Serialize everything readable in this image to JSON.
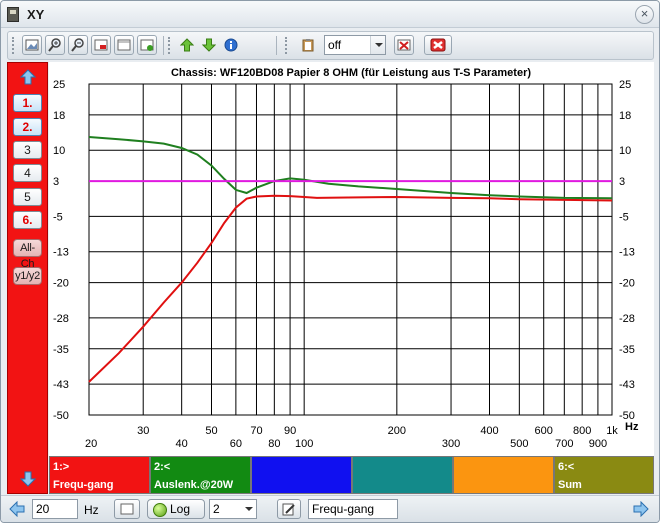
{
  "window": {
    "title": "XY",
    "close_glyph": "×"
  },
  "toolbar": {
    "select_value": "off",
    "icons": [
      "image-icon",
      "zoom-in-icon",
      "zoom-out-icon",
      "screen-red-icon",
      "screen-icon",
      "screen-green-icon",
      "arrow-up-icon",
      "arrow-down-icon",
      "info-icon",
      "clipboard-icon",
      "delete-icon",
      "cancel-icon"
    ]
  },
  "sidebar": {
    "channels": [
      {
        "label": "1.",
        "active": true,
        "highlight": true
      },
      {
        "label": "2.",
        "active": true,
        "highlight": true
      },
      {
        "label": "3",
        "active": false,
        "highlight": false
      },
      {
        "label": "4",
        "active": false,
        "highlight": false
      },
      {
        "label": "5",
        "active": false,
        "highlight": false
      },
      {
        "label": "6.",
        "active": false,
        "highlight": true
      }
    ],
    "all_label": "All-Ch",
    "y_label": "y1/y2"
  },
  "chart_data": {
    "type": "line",
    "title": "Chassis: WF120BD08 Papier 8 OHM (für Leistung aus T-S Parameter)",
    "x_scale": "log",
    "xlim": [
      20,
      1000
    ],
    "ylim": [
      -50,
      25
    ],
    "x_unit": "Hz",
    "x_ticks": [
      {
        "v": 20,
        "label": "20",
        "row": 2
      },
      {
        "v": 30,
        "label": "30",
        "row": 1
      },
      {
        "v": 40,
        "label": "40",
        "row": 2
      },
      {
        "v": 50,
        "label": "50",
        "row": 1
      },
      {
        "v": 60,
        "label": "60",
        "row": 2
      },
      {
        "v": 70,
        "label": "70",
        "row": 1
      },
      {
        "v": 80,
        "label": "80",
        "row": 2
      },
      {
        "v": 90,
        "label": "90",
        "row": 1
      },
      {
        "v": 100,
        "label": "100",
        "row": 2
      },
      {
        "v": 200,
        "label": "200",
        "row": 1
      },
      {
        "v": 300,
        "label": "300",
        "row": 2
      },
      {
        "v": 400,
        "label": "400",
        "row": 1
      },
      {
        "v": 500,
        "label": "500",
        "row": 2
      },
      {
        "v": 600,
        "label": "600",
        "row": 1
      },
      {
        "v": 700,
        "label": "700",
        "row": 2
      },
      {
        "v": 800,
        "label": "800",
        "row": 1
      },
      {
        "v": 900,
        "label": "900",
        "row": 2
      },
      {
        "v": 1000,
        "label": "1k",
        "row": 1
      }
    ],
    "y_ticks_left": [
      {
        "v": 25,
        "label": "25"
      },
      {
        "v": 18,
        "label": "18"
      },
      {
        "v": 10,
        "label": "10"
      },
      {
        "v": 3,
        "label": "3"
      },
      {
        "v": -5,
        "label": "-5"
      },
      {
        "v": -13,
        "label": "-13"
      },
      {
        "v": -20,
        "label": "-20"
      },
      {
        "v": -28,
        "label": "-28"
      },
      {
        "v": -35,
        "label": "-35"
      },
      {
        "v": -43,
        "label": "-43"
      },
      {
        "v": -50,
        "label": "-50"
      }
    ],
    "y_ticks_right": [
      {
        "v": 25,
        "label": "25"
      },
      {
        "v": 18,
        "label": "18"
      },
      {
        "v": 10,
        "label": "10"
      },
      {
        "v": 3,
        "label": "3"
      },
      {
        "v": -5,
        "label": "-5"
      },
      {
        "v": -13,
        "label": "-13"
      },
      {
        "v": -20,
        "label": "-20"
      },
      {
        "v": -28,
        "label": "-28"
      },
      {
        "v": -35,
        "label": "-35"
      },
      {
        "v": -43,
        "label": "-43"
      },
      {
        "v": -50,
        "label": "-50"
      }
    ],
    "hgrid": [
      25,
      18,
      10,
      3,
      -5,
      -13,
      -20,
      -28,
      -35,
      -43,
      -50
    ],
    "series": [
      {
        "name": "Frequ-gang",
        "color": "#e01010",
        "points": [
          [
            20,
            -42.5
          ],
          [
            25,
            -36
          ],
          [
            30,
            -30
          ],
          [
            35,
            -24.5
          ],
          [
            40,
            -20
          ],
          [
            45,
            -15.5
          ],
          [
            50,
            -11
          ],
          [
            55,
            -6.5
          ],
          [
            60,
            -3
          ],
          [
            65,
            -1
          ],
          [
            70,
            -0.5
          ],
          [
            80,
            -0.3
          ],
          [
            90,
            -0.4
          ],
          [
            100,
            -0.6
          ],
          [
            110,
            -0.8
          ],
          [
            150,
            -0.7
          ],
          [
            200,
            -0.6
          ],
          [
            300,
            -0.8
          ],
          [
            400,
            -0.9
          ],
          [
            500,
            -1.1
          ],
          [
            1000,
            -1.4
          ]
        ]
      },
      {
        "name": "Auslenk.@20W",
        "color": "#1f7f1f",
        "points": [
          [
            20,
            13
          ],
          [
            25,
            12.5
          ],
          [
            30,
            12
          ],
          [
            35,
            11.5
          ],
          [
            40,
            10.5
          ],
          [
            45,
            9
          ],
          [
            50,
            6.5
          ],
          [
            55,
            3.5
          ],
          [
            60,
            1
          ],
          [
            65,
            0.3
          ],
          [
            70,
            1.5
          ],
          [
            80,
            3
          ],
          [
            90,
            3.6
          ],
          [
            100,
            3.3
          ],
          [
            120,
            2.4
          ],
          [
            150,
            1.8
          ],
          [
            200,
            1.2
          ],
          [
            300,
            0.3
          ],
          [
            400,
            -0.2
          ],
          [
            500,
            -0.5
          ],
          [
            700,
            -0.8
          ],
          [
            1000,
            -0.9
          ]
        ]
      },
      {
        "name": "",
        "color": "#e019e0",
        "points": [
          [
            20,
            3
          ],
          [
            1000,
            3
          ]
        ]
      }
    ]
  },
  "legend": [
    {
      "top": "1:>",
      "bottom": "Frequ-gang",
      "color": "#f21313"
    },
    {
      "top": "2:<",
      "bottom": "Auslenk.@20W",
      "color": "#128a12"
    },
    {
      "top": "",
      "bottom": "",
      "color": "#1010f0"
    },
    {
      "top": "",
      "bottom": "",
      "color": "#138a8a"
    },
    {
      "top": "",
      "bottom": "",
      "color": "#fb9510"
    },
    {
      "top": "6:<",
      "bottom": "Sum",
      "color": "#8a8a12"
    }
  ],
  "status": {
    "freq_value": "20",
    "freq_unit": "Hz",
    "log_label": "Log",
    "dropdown_value": "2",
    "text_value": "Frequ-gang"
  }
}
